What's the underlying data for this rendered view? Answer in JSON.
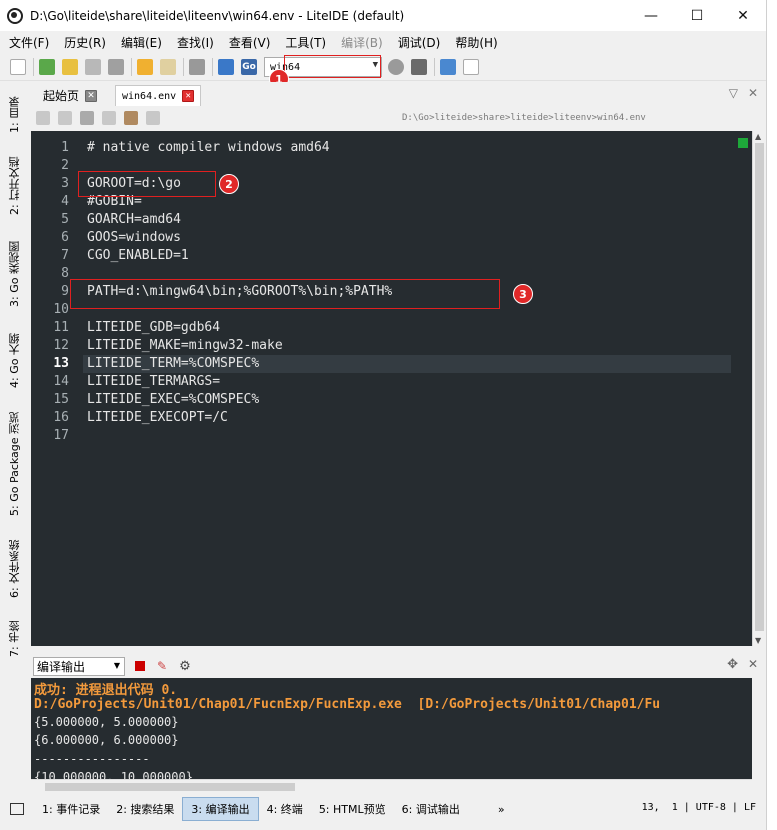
{
  "window": {
    "title": "D:\\Go\\liteide\\share\\liteide\\liteenv\\win64.env - LiteIDE (default)",
    "minimize": "—",
    "maximize": "☐",
    "close": "✕"
  },
  "menu": [
    "文件(F)",
    "历史(R)",
    "编辑(E)",
    "查找(I)",
    "查看(V)",
    "工具(T)",
    "编译(B)",
    "调试(D)",
    "帮助(H)"
  ],
  "toolbar": {
    "env_value": "win64",
    "go_label": "Go"
  },
  "annotations": {
    "one": "1",
    "two": "2",
    "three": "3"
  },
  "side_tabs": [
    "1: 目录",
    "2: 打开文档",
    "3: Go 类视图",
    "4: Go 大纲",
    "5: Go Package 浏览",
    "6: 文件系统",
    "7: 书签"
  ],
  "tabs": {
    "welcome": "起始页",
    "file": "win64.env"
  },
  "editor": {
    "path": "D:\\Go>liteide>share>liteide>liteenv>win64.env",
    "current_line": 13,
    "lines": [
      "# native compiler windows amd64",
      "",
      "GOROOT=d:\\go",
      "#GOBIN=",
      "GOARCH=amd64",
      "GOOS=windows",
      "CGO_ENABLED=1",
      "",
      "PATH=d:\\mingw64\\bin;%GOROOT%\\bin;%PATH%",
      "",
      "LITEIDE_GDB=gdb64",
      "LITEIDE_MAKE=mingw32-make",
      "LITEIDE_TERM=%COMSPEC%",
      "LITEIDE_TERMARGS=",
      "LITEIDE_EXEC=%COMSPEC%",
      "LITEIDE_EXECOPT=/C",
      ""
    ]
  },
  "output": {
    "selector": "编译输出",
    "lines": [
      {
        "text": "成功: 进程退出代码 0.",
        "style": "orange"
      },
      {
        "text": "D:/GoProjects/Unit01/Chap01/FucnExp/FucnExp.exe  [D:/GoProjects/Unit01/Chap01/Fu",
        "style": "orange"
      },
      {
        "text": "{5.000000, 5.000000}",
        "style": "plain"
      },
      {
        "text": "{6.000000, 6.000000}",
        "style": "plain"
      },
      {
        "text": "----------------",
        "style": "plain"
      },
      {
        "text": "{10.000000, 10.000000}",
        "style": "plain"
      }
    ]
  },
  "statusbar": {
    "tabs": [
      "1: 事件记录",
      "2: 搜索结果",
      "3: 编译输出",
      "4: 终端",
      "5: HTML预览",
      "6: 调试输出"
    ],
    "active_index": 2,
    "more": "»",
    "position": "13,  1 | UTF-8 | LF"
  },
  "colors": {
    "editor_bg": "#262c30",
    "output_orange": "#f39a3c",
    "annotation_red": "#e02828"
  }
}
